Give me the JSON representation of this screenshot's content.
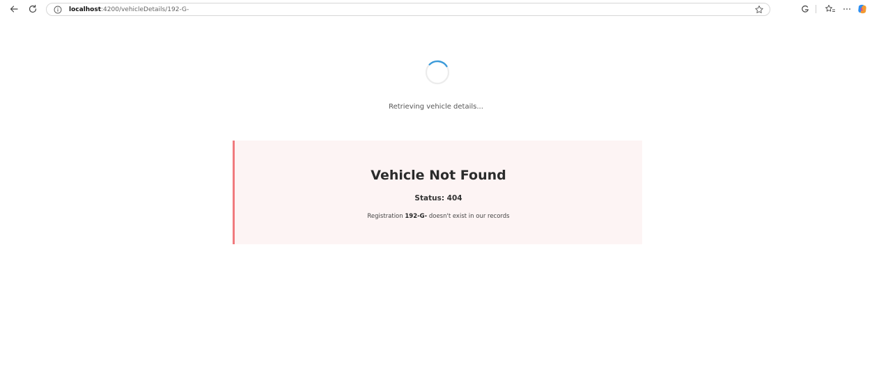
{
  "browser": {
    "url_host": "localhost",
    "url_path": ":4200/vehicleDetails/192-G-"
  },
  "loading": {
    "message": "Retrieving vehicle details..."
  },
  "error": {
    "title": "Vehicle Not Found",
    "status": "Status: 404",
    "message_prefix": "Registration ",
    "registration": "192-G-",
    "message_suffix": " doesn't exist in our records"
  },
  "colors": {
    "card_background": "#fdf4f4",
    "card_accent": "#f07a7e",
    "spinner_accent": "#3b9ad9"
  }
}
